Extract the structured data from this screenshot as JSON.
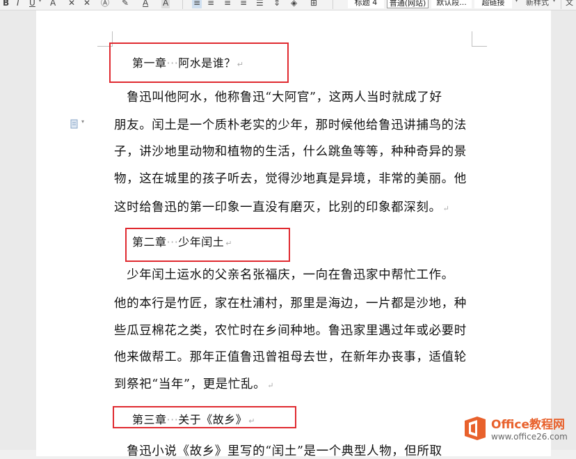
{
  "toolbar": {
    "bold": "B",
    "italic": "I",
    "underline": "U",
    "text_effect": "A",
    "clear": "A",
    "styles": [
      "标题 4",
      "普通(网站)",
      "默认段...",
      "超链接"
    ],
    "new_style": "新样式",
    "text_menu": "文"
  },
  "document": {
    "headings": [
      {
        "chapter": "第一章",
        "dots": "···",
        "title": "阿水是谁？"
      },
      {
        "chapter": "第二章",
        "dots": "···",
        "title": "少年闰土"
      },
      {
        "chapter": "第三章",
        "dots": "···",
        "title": "关于《故乡》"
      }
    ],
    "paragraph1": [
      "　鲁迅叫他阿水，他称鲁迅“大阿官”，这两人当时就成了好",
      "朋友。闰土是一个质朴老实的少年，那时候他给鲁迅讲捕鸟的法",
      "子，讲沙地里动物和植物的生活，什么跳鱼等等，种种奇异的景",
      "物，这在城里的孩子听去，觉得沙地真是异境，非常的美丽。他",
      "这时给鲁迅的第一印象一直没有磨灭，比别的印象都深刻。"
    ],
    "paragraph2": [
      "　少年闰土运水的父亲名张福庆，一向在鲁迅家中帮忙工作。",
      "他的本行是竹匠，家在杜浦村，那里是海边，一片都是沙地，种",
      "些瓜豆棉花之类，农忙时在乡间种地。鲁迅家里遇过年或必要时",
      "他来做帮工。那年正值鲁迅曾祖母去世，在新年办丧事，适值轮",
      "到祭祀“当年”，更是忙乱。"
    ],
    "paragraph3": [
      "　鲁迅小说《故乡》里写的“闰土”是一个典型人物，但所取"
    ],
    "para_mark": "↵"
  },
  "watermark": {
    "title": "Office教程网",
    "url": "www.office26.com",
    "brand_color": "#e8612c"
  },
  "colors": {
    "highlight_box": "#e0292f"
  }
}
